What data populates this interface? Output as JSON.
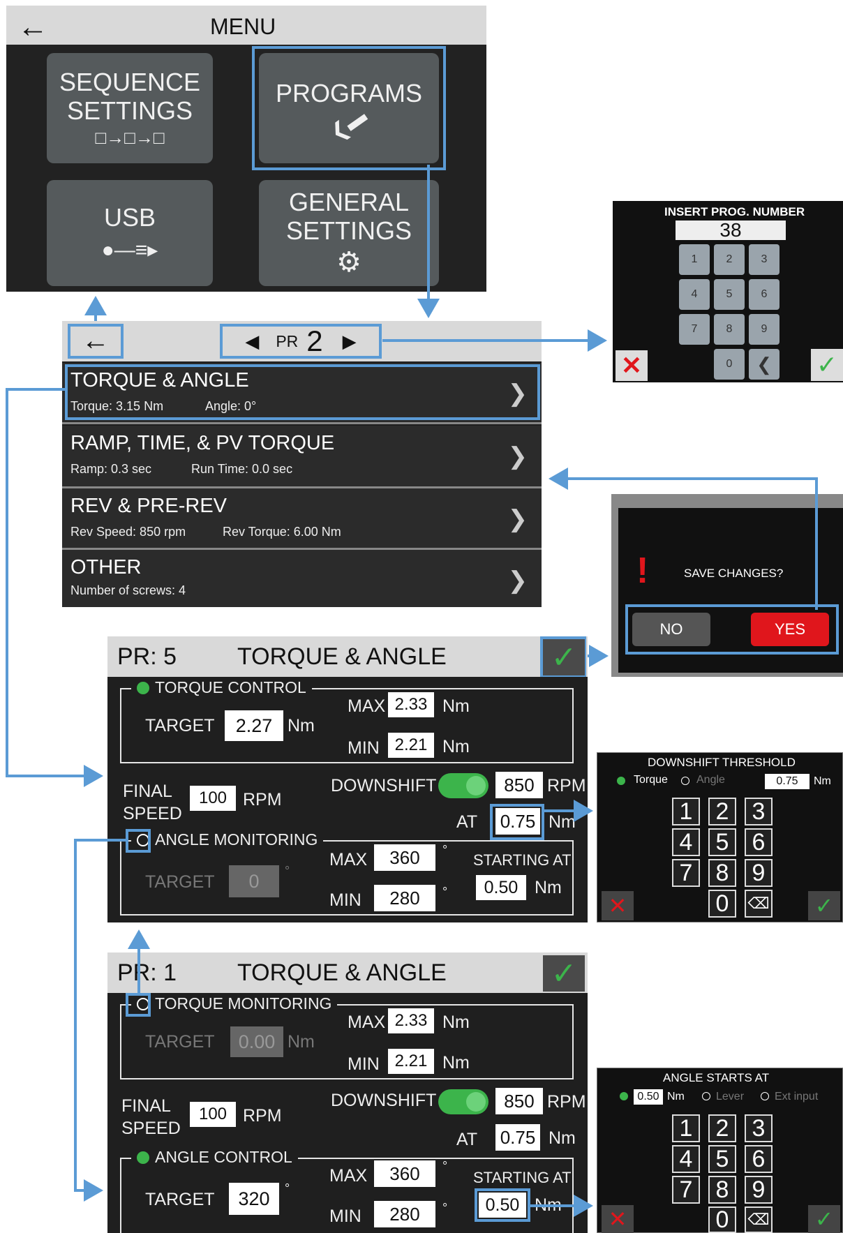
{
  "menu": {
    "title": "MENU",
    "tiles": {
      "sequence_line1": "SEQUENCE",
      "sequence_line2": "SETTINGS",
      "programs": "PROGRAMS",
      "usb": "USB",
      "general_line1": "GENERAL",
      "general_line2": "SETTINGS"
    }
  },
  "program_list": {
    "pr_label": "PR",
    "pr_number": "2",
    "rows": [
      {
        "title": "TORQUE & ANGLE",
        "sub1": "Torque: 3.15 Nm",
        "sub2": "Angle: 0°"
      },
      {
        "title": "RAMP, TIME, & PV TORQUE",
        "sub1": "Ramp: 0.3 sec",
        "sub2": "Run Time: 0.0 sec"
      },
      {
        "title": "REV & PRE-REV",
        "sub1": "Rev Speed: 850 rpm",
        "sub2": "Rev Torque: 6.00 Nm"
      },
      {
        "title": "OTHER",
        "sub1": "Number of screws: 4"
      }
    ]
  },
  "prog_number_popup": {
    "title": "INSERT PROG. NUMBER",
    "value": "38",
    "keys": [
      "1",
      "2",
      "3",
      "4",
      "5",
      "6",
      "7",
      "8",
      "9",
      "0"
    ]
  },
  "save_popup": {
    "question": "SAVE CHANGES?",
    "no": "NO",
    "yes": "YES"
  },
  "panel_pr5": {
    "pr": "PR: 5",
    "title": "TORQUE & ANGLE",
    "torque_group": "TORQUE CONTROL",
    "target_label": "TARGET",
    "target": "2.27",
    "unit_nm": "Nm",
    "max_label": "MAX",
    "max": "2.33",
    "min_label": "MIN",
    "min": "2.21",
    "final_speed_1": "FINAL",
    "final_speed_2": "SPEED",
    "final_speed": "100",
    "rpm": "RPM",
    "downshift": "DOWNSHIFT",
    "downshift_rpm": "850",
    "at": "AT",
    "at_value": "0.75",
    "angle_group": "ANGLE MONITORING",
    "angle_target": "0",
    "deg": "°",
    "angle_max": "360",
    "angle_min": "280",
    "starting_at": "STARTING AT",
    "starting_value": "0.50"
  },
  "downshift_popup": {
    "title": "DOWNSHIFT THRESHOLD",
    "opt1": "Torque",
    "opt2": "Angle",
    "value": "0.75",
    "unit": "Nm",
    "keys": [
      "1",
      "2",
      "3",
      "4",
      "5",
      "6",
      "7",
      "8",
      "9",
      "0"
    ]
  },
  "panel_pr1": {
    "pr": "PR: 1",
    "title": "TORQUE & ANGLE",
    "torque_group": "TORQUE MONITORING",
    "target_label": "TARGET",
    "target": "0.00",
    "unit_nm": "Nm",
    "max_label": "MAX",
    "max": "2.33",
    "min_label": "MIN",
    "min": "2.21",
    "final_speed_1": "FINAL",
    "final_speed_2": "SPEED",
    "final_speed": "100",
    "rpm": "RPM",
    "downshift": "DOWNSHIFT",
    "downshift_rpm": "850",
    "at": "AT",
    "at_value": "0.75",
    "angle_group": "ANGLE CONTROL",
    "angle_target": "320",
    "deg": "°",
    "angle_max": "360",
    "angle_min": "280",
    "starting_at": "STARTING AT",
    "starting_value": "0.50"
  },
  "angle_start_popup": {
    "title": "ANGLE STARTS AT",
    "value": "0.50",
    "unit": "Nm",
    "opt2": "Lever",
    "opt3": "Ext input",
    "keys": [
      "1",
      "2",
      "3",
      "4",
      "5",
      "6",
      "7",
      "8",
      "9",
      "0"
    ]
  },
  "colors": {
    "accent": "#5b9bd5",
    "green": "#3cb44b",
    "red": "#e0161c"
  }
}
